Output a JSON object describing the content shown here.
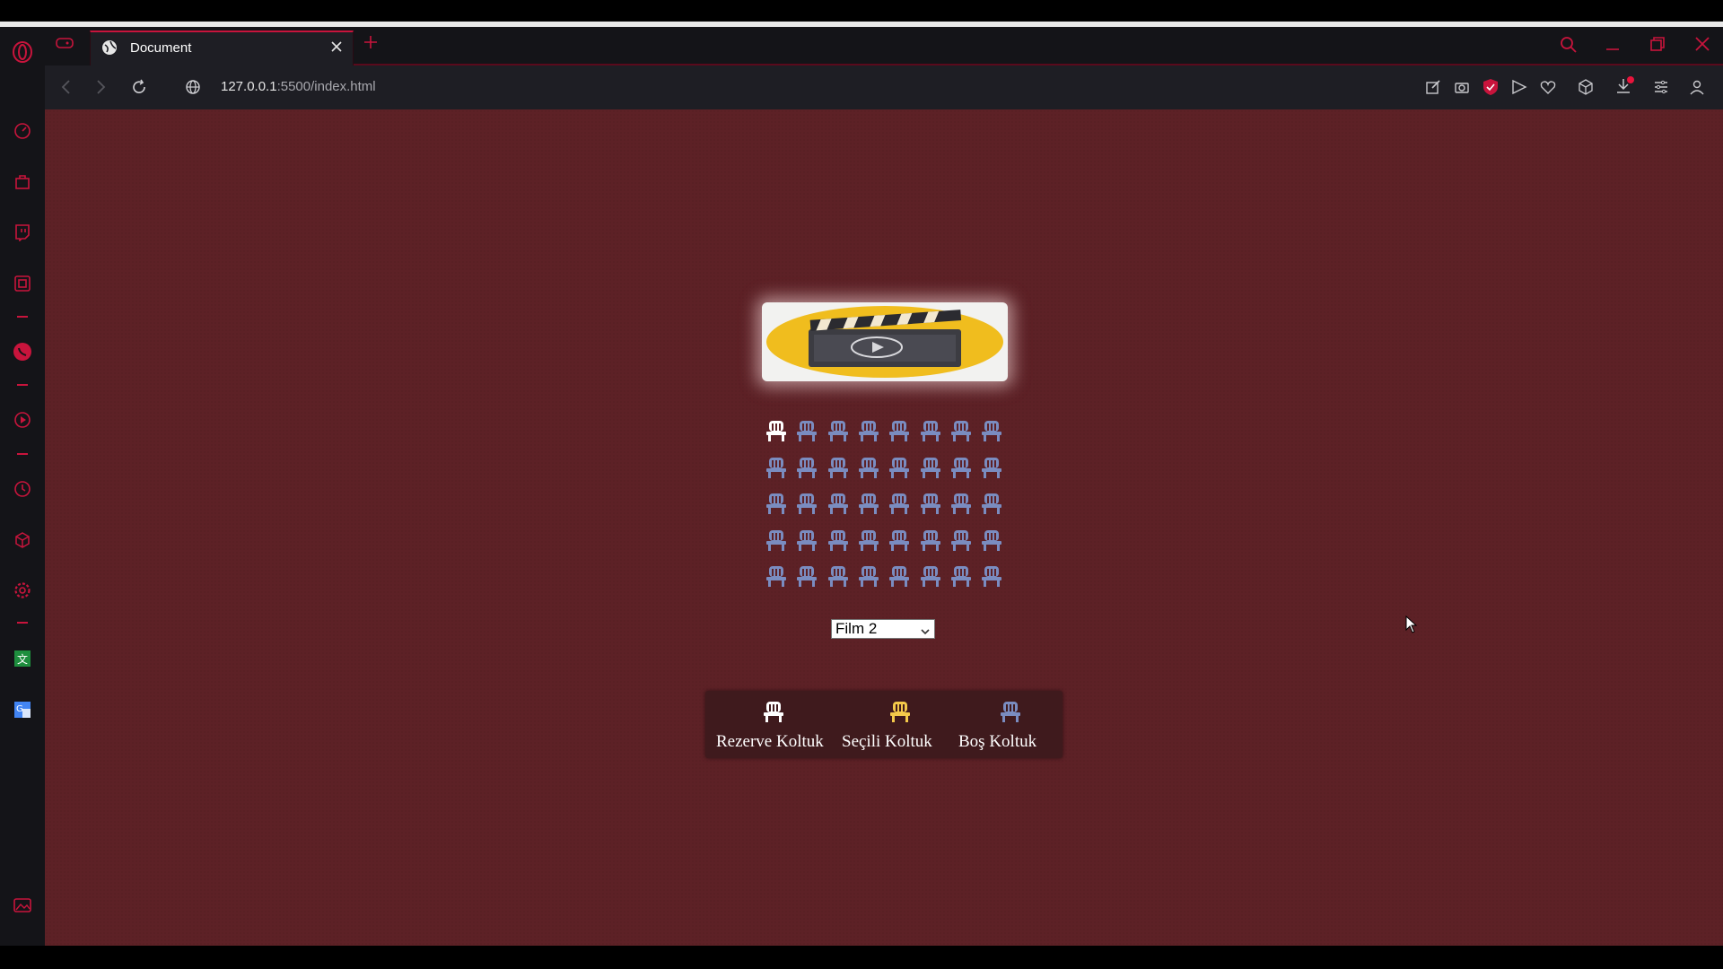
{
  "browser": {
    "tab": {
      "title": "Document"
    },
    "address": {
      "host": "127.0.0.1",
      "rest": ":5500/index.html"
    }
  },
  "page": {
    "movie_select": {
      "selected": "Film 2"
    },
    "seat_rows": [
      [
        "reserved",
        "empty",
        "empty",
        "empty",
        "empty",
        "empty",
        "empty",
        "empty"
      ],
      [
        "empty",
        "empty",
        "empty",
        "empty",
        "empty",
        "empty",
        "empty",
        "empty"
      ],
      [
        "empty",
        "empty",
        "empty",
        "empty",
        "empty",
        "empty",
        "empty",
        "empty"
      ],
      [
        "empty",
        "empty",
        "empty",
        "empty",
        "empty",
        "empty",
        "empty",
        "empty"
      ],
      [
        "empty",
        "empty",
        "empty",
        "empty",
        "empty",
        "empty",
        "empty",
        "empty"
      ]
    ],
    "legend": {
      "reserved": "Rezerve Koltuk",
      "selected": "Seçili Koltuk",
      "empty": "Boş Koltuk"
    }
  },
  "colors": {
    "accent": "#c8143c",
    "page_bg": "#5d2126",
    "seat_empty": "#7a8cc0",
    "seat_reserved": "#ffffff",
    "seat_selected": "#f4c94a",
    "legend_bg": "#3f1a1d"
  },
  "icons": {
    "sidebar": [
      "speed-dial-icon",
      "shopping-bag-icon",
      "twitch-icon",
      "extensions-icon",
      "whatsapp-icon",
      "player-icon",
      "history-icon",
      "cube-icon",
      "settings-icon",
      "translate-icon",
      "google-translate-icon",
      "pinboard-icon",
      "more-icon"
    ],
    "toolbar": [
      "snapshot-edit-icon",
      "camera-icon",
      "vpn-shield-icon",
      "send-icon",
      "heart-icon",
      "cube-icon",
      "download-icon",
      "easy-setup-icon",
      "account-icon"
    ]
  }
}
